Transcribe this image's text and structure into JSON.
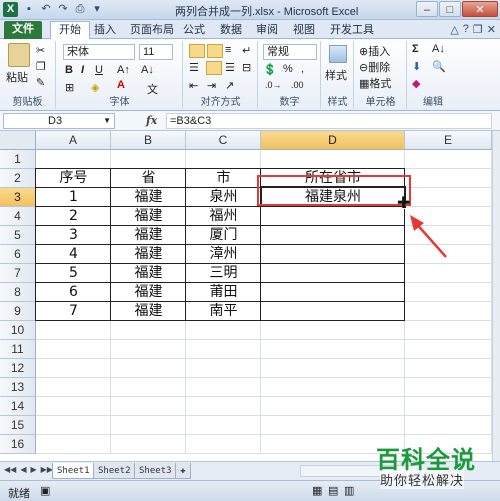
{
  "window": {
    "title": "两列合并成一列.xlsx - Microsoft Excel",
    "app_logo": "X"
  },
  "quick_access": [
    "save-icon",
    "undo-icon",
    "redo-icon",
    "print-preview-icon",
    "customize-icon"
  ],
  "ribbon_tabs": [
    "文件",
    "开始",
    "插入",
    "页面布局",
    "公式",
    "数据",
    "审阅",
    "视图",
    "开发工具"
  ],
  "ribbon": {
    "clipboard": {
      "label": "剪贴板",
      "paste": "粘贴"
    },
    "font": {
      "label": "字体",
      "name": "宋体",
      "size": "11"
    },
    "alignment": {
      "label": "对齐方式"
    },
    "number": {
      "label": "数字",
      "format": "常规"
    },
    "styles": {
      "label": "样式",
      "button": "样式"
    },
    "cells": {
      "label": "单元格",
      "insert": "插入",
      "delete": "删除",
      "format": "格式"
    },
    "editing": {
      "label": "编辑"
    }
  },
  "formula_bar": {
    "name_box": "D3",
    "fx": "fx",
    "formula": "=B3&C3"
  },
  "grid": {
    "columns": [
      "A",
      "B",
      "C",
      "D",
      "E"
    ],
    "rows": [
      "1",
      "2",
      "3",
      "4",
      "5",
      "6",
      "7",
      "8",
      "9",
      "10",
      "11",
      "12",
      "13",
      "14",
      "15",
      "16"
    ],
    "header": [
      "序号",
      "省",
      "市",
      "所在省市"
    ],
    "data": [
      [
        "1",
        "福建",
        "泉州",
        "福建泉州"
      ],
      [
        "2",
        "福建",
        "福州",
        ""
      ],
      [
        "3",
        "福建",
        "厦门",
        ""
      ],
      [
        "4",
        "福建",
        "漳州",
        ""
      ],
      [
        "5",
        "福建",
        "三明",
        ""
      ],
      [
        "6",
        "福建",
        "莆田",
        ""
      ],
      [
        "7",
        "福建",
        "南平",
        ""
      ]
    ],
    "active_cell": "D3"
  },
  "sheets": [
    "Sheet1",
    "Sheet2",
    "Sheet3"
  ],
  "status": {
    "ready": "就绪"
  },
  "watermark": {
    "line1": "百科全说",
    "line2": "助你轻松解决"
  },
  "colors": {
    "annotation": "#e53935",
    "file_tab": "#2b7a3c",
    "selected_header": "#f2c160"
  }
}
